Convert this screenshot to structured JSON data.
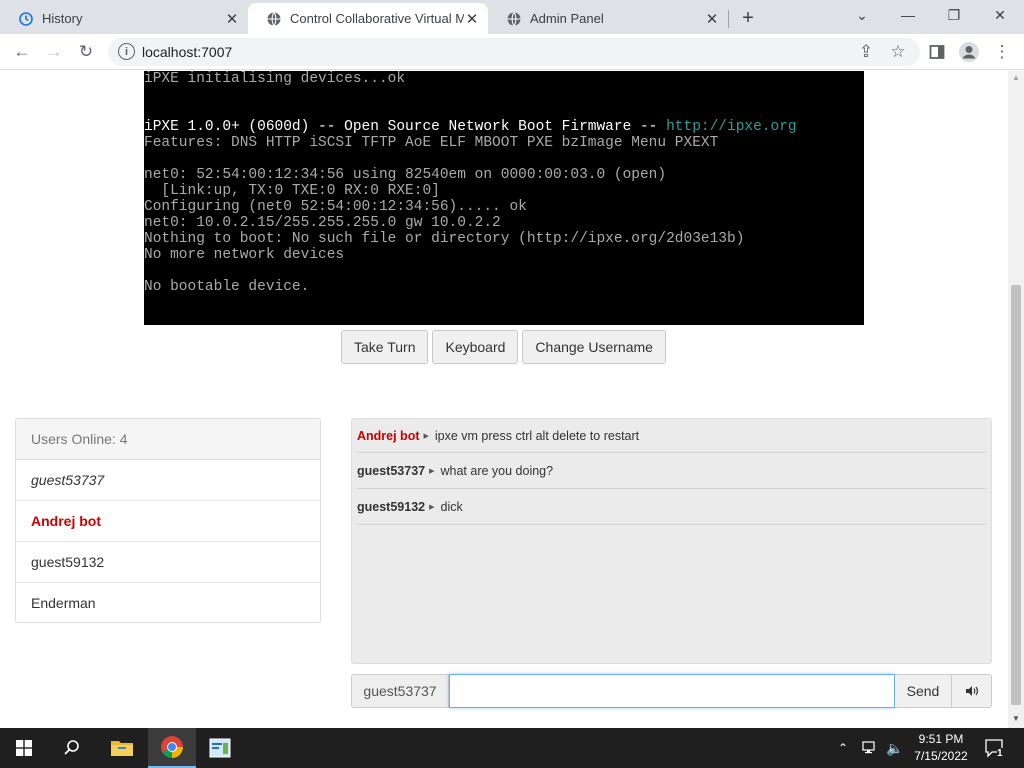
{
  "browser": {
    "tabs": [
      {
        "title": "History",
        "icon": "history-icon"
      },
      {
        "title": "Control Collaborative Virtual Ma",
        "icon": "globe-icon"
      },
      {
        "title": "Admin Panel",
        "icon": "globe-icon"
      }
    ],
    "url": "localhost:7007"
  },
  "vm": {
    "lines": [
      "iPXE initialising devices...ok",
      "",
      "",
      "",
      "Features: DNS HTTP iSCSI TFTP AoE ELF MBOOT PXE bzImage Menu PXEXT",
      "",
      "net0: 52:54:00:12:34:56 using 82540em on 0000:00:03.0 (open)",
      "  [Link:up, TX:0 TXE:0 RX:0 RXE:0]",
      "Configuring (net0 52:54:00:12:34:56)..... ok",
      "net0: 10.0.2.15/255.255.255.0 gw 10.0.2.2",
      "Nothing to boot: No such file or directory (http://ipxe.org/2d03e13b)",
      "No more network devices",
      "",
      "No bootable device."
    ],
    "banner_prefix": "iPXE 1.0.0+ (0600d) -- Open Source Network Boot Firmware -- ",
    "banner_link": "http://ipxe.org",
    "buttons": {
      "take_turn": "Take Turn",
      "keyboard": "Keyboard",
      "change_username": "Change Username"
    }
  },
  "users": {
    "header": "Users Online: 4",
    "list": [
      {
        "name": "guest53737"
      },
      {
        "name": "Andrej bot"
      },
      {
        "name": "guest59132"
      },
      {
        "name": "Enderman"
      }
    ]
  },
  "chat": {
    "messages": [
      {
        "user": "Andrej bot",
        "text": "ipxe vm press ctrl alt delete to restart"
      },
      {
        "user": "guest53737",
        "text": "what are you doing?"
      },
      {
        "user": "guest59132",
        "text": "dick"
      }
    ],
    "username": "guest53737",
    "input_value": "",
    "send_label": "Send"
  },
  "taskbar": {
    "time": "9:51 PM",
    "date": "7/15/2022",
    "notifications": "1"
  }
}
